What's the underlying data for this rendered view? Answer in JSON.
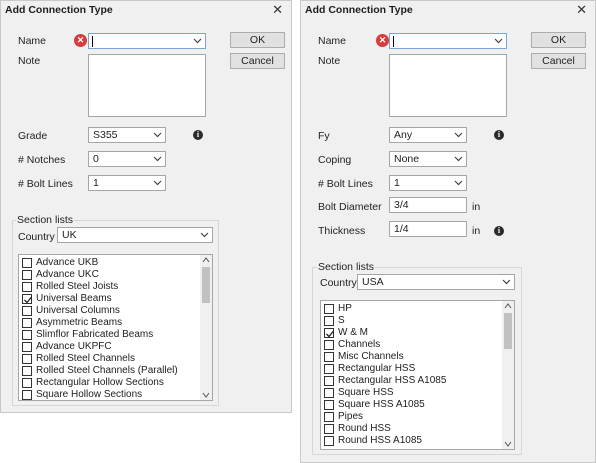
{
  "left": {
    "title": "Add Connection Type",
    "name_label": "Name",
    "name_value": "",
    "note_label": "Note",
    "ok": "OK",
    "cancel": "Cancel",
    "fields": [
      {
        "label": "Grade",
        "value": "S355"
      },
      {
        "label": "# Notches",
        "value": "0"
      },
      {
        "label": "# Bolt Lines",
        "value": "1"
      }
    ],
    "section_title": "Section lists",
    "country_label": "Country",
    "country_value": "UK",
    "sections": [
      {
        "label": "Advance UKB",
        "checked": false
      },
      {
        "label": "Advance UKC",
        "checked": false
      },
      {
        "label": "Rolled Steel Joists",
        "checked": false
      },
      {
        "label": "Universal Beams",
        "checked": true
      },
      {
        "label": "Universal Columns",
        "checked": false
      },
      {
        "label": "Asymmetric Beams",
        "checked": false
      },
      {
        "label": "Slimflor Fabricated Beams",
        "checked": false
      },
      {
        "label": "Advance UKPFC",
        "checked": false
      },
      {
        "label": "Rolled Steel Channels",
        "checked": false
      },
      {
        "label": "Rolled Steel Channels (Parallel)",
        "checked": false
      },
      {
        "label": "Rectangular Hollow Sections",
        "checked": false
      },
      {
        "label": "Square Hollow Sections",
        "checked": false
      }
    ]
  },
  "right": {
    "title": "Add Connection Type",
    "name_label": "Name",
    "name_value": "",
    "note_label": "Note",
    "ok": "OK",
    "cancel": "Cancel",
    "fields": [
      {
        "label": "Fy",
        "value": "Any"
      },
      {
        "label": "Coping",
        "value": "None"
      },
      {
        "label": "# Bolt Lines",
        "value": "1"
      }
    ],
    "bolt_diameter_label": "Bolt Diameter",
    "bolt_diameter_value": "3/4",
    "thickness_label": "Thickness",
    "thickness_value": "1/4",
    "unit": "in",
    "section_title": "Section lists",
    "country_label": "Country",
    "country_value": "USA",
    "sections": [
      {
        "label": "HP",
        "checked": false
      },
      {
        "label": "S",
        "checked": false
      },
      {
        "label": "W & M",
        "checked": true
      },
      {
        "label": "Channels",
        "checked": false
      },
      {
        "label": "Misc Channels",
        "checked": false
      },
      {
        "label": "Rectangular HSS",
        "checked": false
      },
      {
        "label": "Rectangular HSS A1085",
        "checked": false
      },
      {
        "label": "Square HSS",
        "checked": false
      },
      {
        "label": "Square HSS A1085",
        "checked": false
      },
      {
        "label": "Pipes",
        "checked": false
      },
      {
        "label": "Round HSS",
        "checked": false
      },
      {
        "label": "Round HSS A1085",
        "checked": false
      }
    ]
  },
  "icons": {
    "close": "close-icon",
    "error": "error-icon",
    "info": "info-icon",
    "dropdown": "chevron-down-icon"
  }
}
